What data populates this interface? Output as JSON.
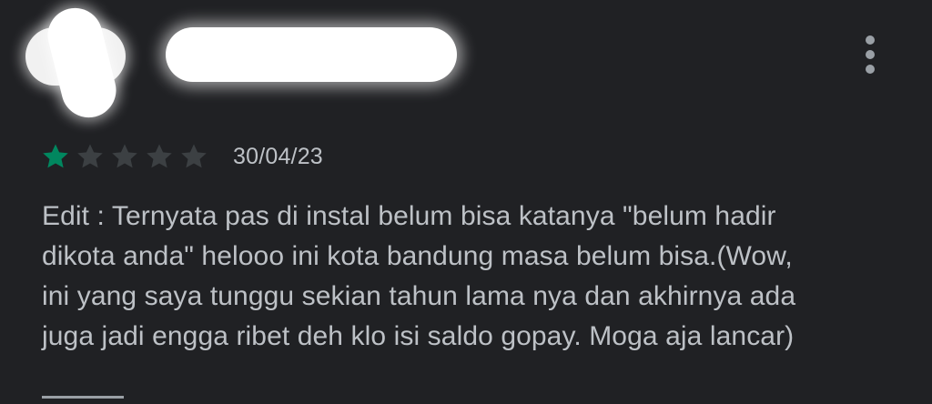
{
  "review": {
    "rating": 1,
    "max_rating": 5,
    "date": "30/04/23",
    "text_lines": [
      "Edit : Ternyata pas di instal belum bisa katanya \"belum hadir",
      "dikota anda\" helooo ini kota bandung masa belum bisa.(Wow,",
      "ini yang saya tunggu sekian tahun lama nya dan akhirnya ada",
      "juga jadi engga ribet deh klo isi saldo gopay. Moga aja lancar)"
    ]
  },
  "colors": {
    "background": "#202124",
    "star_filled": "#01875f",
    "star_empty": "#3c4043",
    "text": "#bdc1c6",
    "icon": "#9aa0a6"
  },
  "icons": {
    "more": "more-vert-icon",
    "star": "star-icon"
  }
}
